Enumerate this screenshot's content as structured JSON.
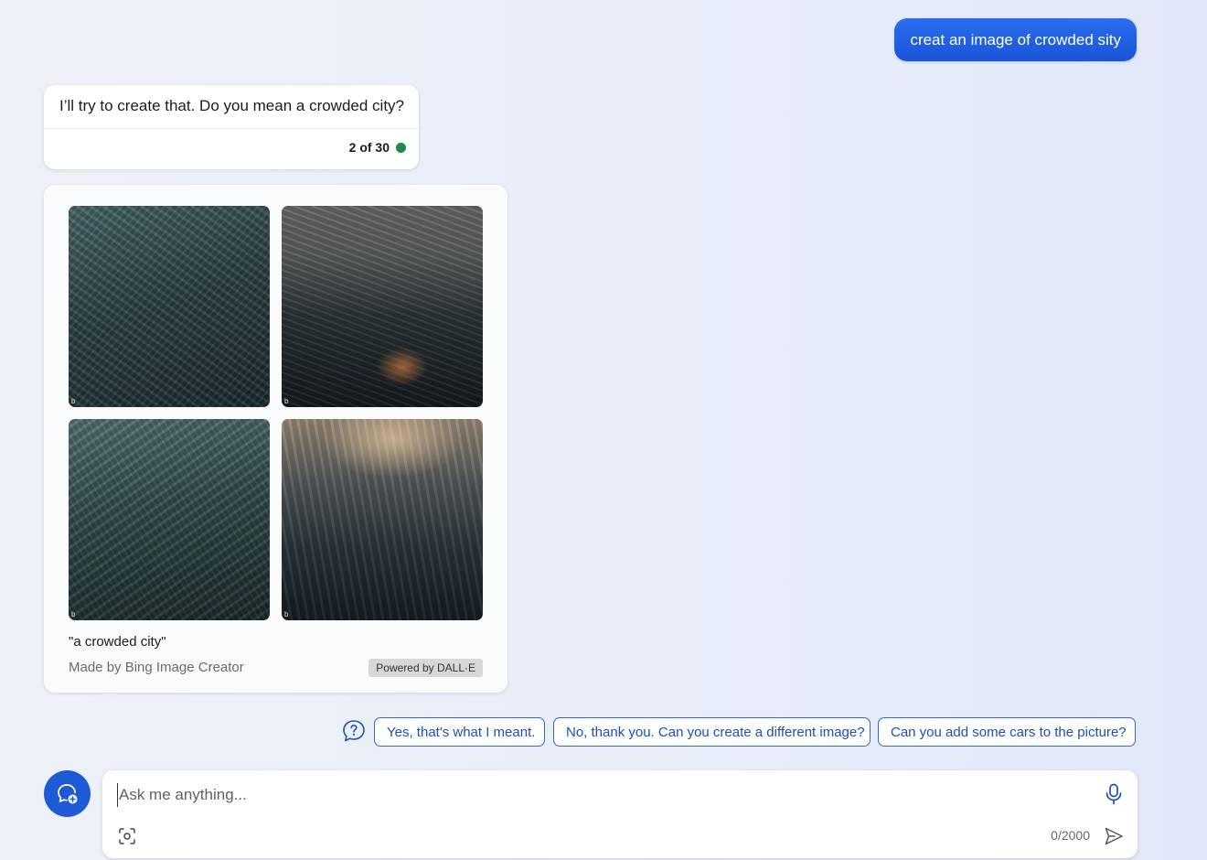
{
  "user_message": {
    "text": "creat an image of crowded sity"
  },
  "bot_reply": {
    "text": "I’ll try to create that. Do you mean a crowded city?",
    "counter": "2 of 30",
    "status_color": "#1f8a45"
  },
  "image_card": {
    "images": [
      {
        "badge": "b"
      },
      {
        "badge": "b"
      },
      {
        "badge": "b"
      },
      {
        "badge": "b"
      }
    ],
    "caption": "\"a crowded city\"",
    "made_by": "Made by Bing Image Creator",
    "powered_by": "Powered by DALL·E"
  },
  "suggestions": {
    "icon": "question-bubble-icon",
    "items": [
      "Yes, that's what I meant.",
      "No, thank you. Can you create a different image?",
      "Can you add some cars to the picture?"
    ]
  },
  "composer": {
    "placeholder": "Ask me anything...",
    "value": "",
    "char_count": "0/2000",
    "accent_color": "#1f5ad6"
  }
}
